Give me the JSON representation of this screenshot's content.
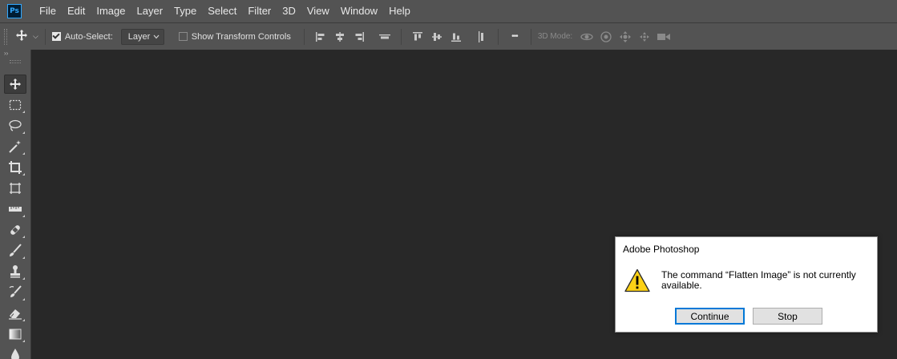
{
  "app": {
    "logo_text": "Ps",
    "accent": "#31a8ff"
  },
  "menu": [
    "File",
    "Edit",
    "Image",
    "Layer",
    "Type",
    "Select",
    "Filter",
    "3D",
    "View",
    "Window",
    "Help"
  ],
  "options": {
    "auto_select_label": "Auto-Select:",
    "auto_select_checked": true,
    "layer_select_value": "Layer",
    "show_transform_label": "Show Transform Controls",
    "show_transform_checked": false,
    "mode_3d_label": "3D Mode:",
    "more_label": "•••"
  },
  "toolbar": {
    "collapse_label": "››",
    "tools": [
      "move-tool",
      "rectangular-marquee-tool",
      "lasso-tool",
      "magic-wand-tool",
      "crop-tool",
      "frame-tool",
      "ruler-tool",
      "spot-healing-tool",
      "brush-tool",
      "clone-stamp-tool",
      "history-brush-tool",
      "eraser-tool",
      "gradient-tool",
      "blur-tool"
    ]
  },
  "dialog": {
    "title": "Adobe Photoshop",
    "message": "The command “Flatten Image” is not currently available.",
    "continue_label": "Continue",
    "stop_label": "Stop",
    "icon": "warning-icon"
  }
}
